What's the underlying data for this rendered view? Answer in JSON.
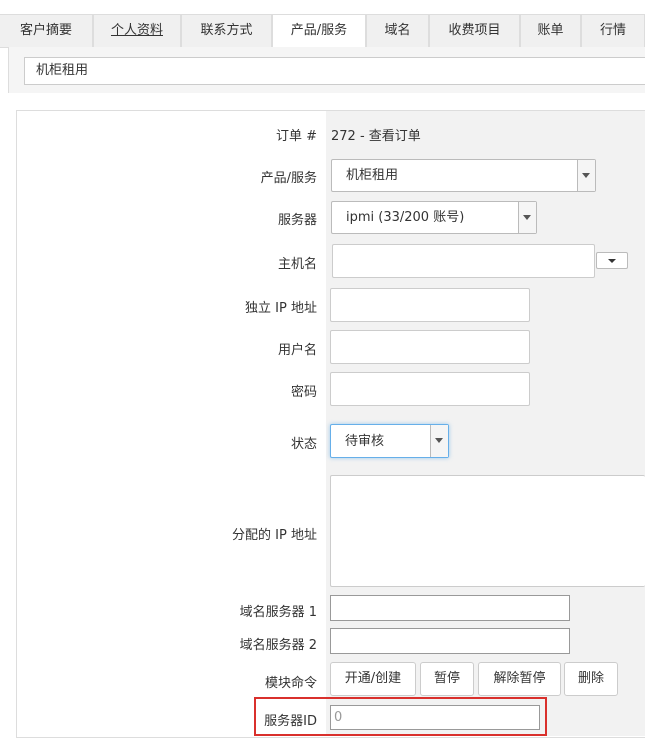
{
  "tabs": [
    {
      "label": "客户摘要"
    },
    {
      "label": "个人资料"
    },
    {
      "label": "联系方式"
    },
    {
      "label": "产品/服务"
    },
    {
      "label": "域名"
    },
    {
      "label": "收费项目"
    },
    {
      "label": "账单"
    },
    {
      "label": "行情"
    }
  ],
  "top_select": {
    "value": "机柜租用"
  },
  "form": {
    "order_label": "订单 #",
    "order_value": "272 - 查看订单",
    "product_label": "产品/服务",
    "product_value": "机柜租用",
    "server_label": "服务器",
    "server_value": "ipmi (33/200 账号)",
    "hostname_label": "主机名",
    "hostname_value": "",
    "dedicated_ip_label": "独立 IP 地址",
    "username_label": "用户名",
    "password_label": "密码",
    "status_label": "状态",
    "status_value": "待审核",
    "assigned_ips_label": "分配的 IP 地址",
    "ns1_label": "域名服务器 1",
    "ns2_label": "域名服务器 2",
    "module_label": "模块命令",
    "server_id_label": "服务器ID",
    "server_id_value": "0"
  },
  "module_buttons": [
    "开通/创建",
    "暂停",
    "解除暂停",
    "删除"
  ],
  "colors": {
    "highlight": "#d9302c",
    "value_bg": "#f2f2f2",
    "status_border": "#66afe9"
  }
}
